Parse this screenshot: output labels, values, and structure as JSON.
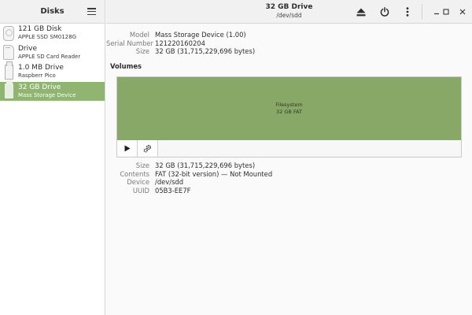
{
  "sidebar": {
    "title": "Disks",
    "items": [
      {
        "name": "121 GB Disk",
        "sub": "APPLE SSD SM0128G",
        "icon": "hard-disk-icon",
        "selected": false
      },
      {
        "name": "Drive",
        "sub": "APPLE SD Card Reader",
        "icon": "sd-card-icon",
        "selected": false
      },
      {
        "name": "1.0 MB Drive",
        "sub": "Raspberr Pico",
        "icon": "usb-drive-icon",
        "selected": false
      },
      {
        "name": "32 GB Drive",
        "sub": "Mass Storage Device",
        "icon": "usb-drive-icon",
        "selected": true
      }
    ]
  },
  "header": {
    "title": "32 GB Drive",
    "subtitle": "/dev/sdd"
  },
  "drive_info": {
    "rows": [
      {
        "key": "Model",
        "value": "Mass Storage Device (1.00)"
      },
      {
        "key": "Serial Number",
        "value": "121220160204"
      },
      {
        "key": "Size",
        "value": "32 GB (31,715,229,696 bytes)"
      }
    ]
  },
  "volumes": {
    "label": "Volumes",
    "partition": {
      "line1": "Filesystem",
      "line2": "32 GB FAT",
      "color": "#87a866"
    }
  },
  "volume_info": {
    "rows": [
      {
        "key": "Size",
        "value": "32 GB (31,715,229,696 bytes)"
      },
      {
        "key": "Contents",
        "value": "FAT (32-bit version) — Not Mounted"
      },
      {
        "key": "Device",
        "value": "/dev/sdd"
      },
      {
        "key": "UUID",
        "value": "05B3-EE7F"
      }
    ]
  },
  "colors": {
    "accent": "#8fb570",
    "partition": "#87a866"
  }
}
